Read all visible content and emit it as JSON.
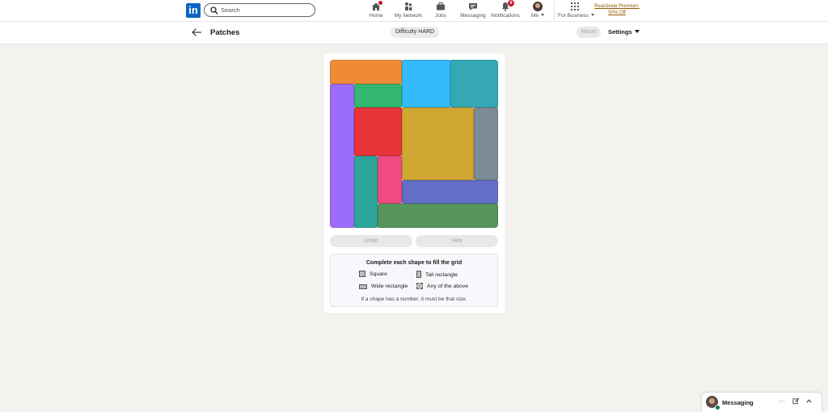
{
  "nav": {
    "logo": "in",
    "search_placeholder": "Search",
    "items": [
      {
        "label": "Home",
        "icon": "home-icon",
        "badge": ""
      },
      {
        "label": "My Network",
        "icon": "people-icon",
        "badge": ""
      },
      {
        "label": "Jobs",
        "icon": "briefcase-icon",
        "badge": ""
      },
      {
        "label": "Messaging",
        "icon": "chat-icon",
        "badge": ""
      },
      {
        "label": "Notifications",
        "icon": "bell-icon",
        "badge": "8"
      },
      {
        "label": "Me",
        "icon": "avatar",
        "badge": ""
      },
      {
        "label": "For Business",
        "icon": "grid-icon",
        "badge": ""
      }
    ],
    "premium_line1": "Reactivate Premium:",
    "premium_line2": "50% Off"
  },
  "subheader": {
    "title": "Patches",
    "difficulty": "Difficulty HARD",
    "reset_label": "Reset",
    "settings_label": "Settings"
  },
  "game": {
    "grid_size": 7,
    "pieces": [
      {
        "name": "orange",
        "color": "#ef8b35",
        "row": 0,
        "col": 0,
        "rows": 1,
        "cols": 3
      },
      {
        "name": "sky",
        "color": "#33bbfe",
        "row": 0,
        "col": 3,
        "rows": 2,
        "cols": 2
      },
      {
        "name": "teal",
        "color": "#34a9b5",
        "row": 0,
        "col": 5,
        "rows": 2,
        "cols": 2
      },
      {
        "name": "purple",
        "color": "#9b6dfb",
        "row": 1,
        "col": 0,
        "rows": 6,
        "cols": 1
      },
      {
        "name": "green",
        "color": "#33b872",
        "row": 1,
        "col": 1,
        "rows": 1,
        "cols": 2
      },
      {
        "name": "red",
        "color": "#e63438",
        "row": 2,
        "col": 1,
        "rows": 2,
        "cols": 2
      },
      {
        "name": "gold",
        "color": "#d0a632",
        "row": 2,
        "col": 3,
        "rows": 3,
        "cols": 3
      },
      {
        "name": "slate",
        "color": "#7b8c94",
        "row": 2,
        "col": 6,
        "rows": 3,
        "cols": 1
      },
      {
        "name": "sea",
        "color": "#2ea59a",
        "row": 4,
        "col": 1,
        "rows": 3,
        "cols": 1
      },
      {
        "name": "pink",
        "color": "#ef4b82",
        "row": 4,
        "col": 2,
        "rows": 2,
        "cols": 1
      },
      {
        "name": "indigo",
        "color": "#646ec7",
        "row": 5,
        "col": 3,
        "rows": 1,
        "cols": 4
      },
      {
        "name": "moss",
        "color": "#57965a",
        "row": 6,
        "col": 2,
        "rows": 1,
        "cols": 5
      }
    ],
    "undo_label": "Undo",
    "hint_label": "Hint"
  },
  "legend": {
    "title": "Complete each shape to fill the grid",
    "square": "Square",
    "tall": "Tall rectangle",
    "wide": "Wide rectangle",
    "any": "Any of the above",
    "note": "If a shape has a number, it must be that size."
  },
  "messaging": {
    "label": "Messaging"
  }
}
